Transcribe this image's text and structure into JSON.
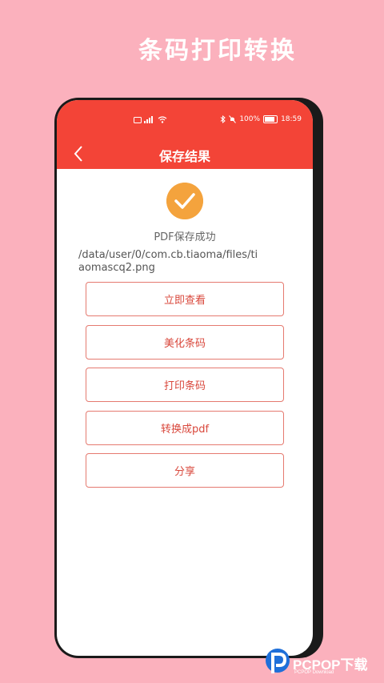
{
  "headline": "条码打印转换",
  "status_bar": {
    "battery": "100%",
    "time": "18:59"
  },
  "nav": {
    "title": "保存结果"
  },
  "result": {
    "message": "PDF保存成功",
    "file_path": "/data/user/0/com.cb.tiaoma/files/tiaomascq2.png"
  },
  "buttons": [
    {
      "label": "立即查看"
    },
    {
      "label": "美化条码"
    },
    {
      "label": "打印条码"
    },
    {
      "label": "转换成pdf"
    },
    {
      "label": "分享"
    }
  ],
  "watermark": {
    "title": "PCPOP下载",
    "subtitle": "PCPOP Download"
  },
  "colors": {
    "background": "#fbb1bd",
    "accent": "#f34437",
    "success_icon": "#f4a33d",
    "button_border": "#e57a70"
  }
}
